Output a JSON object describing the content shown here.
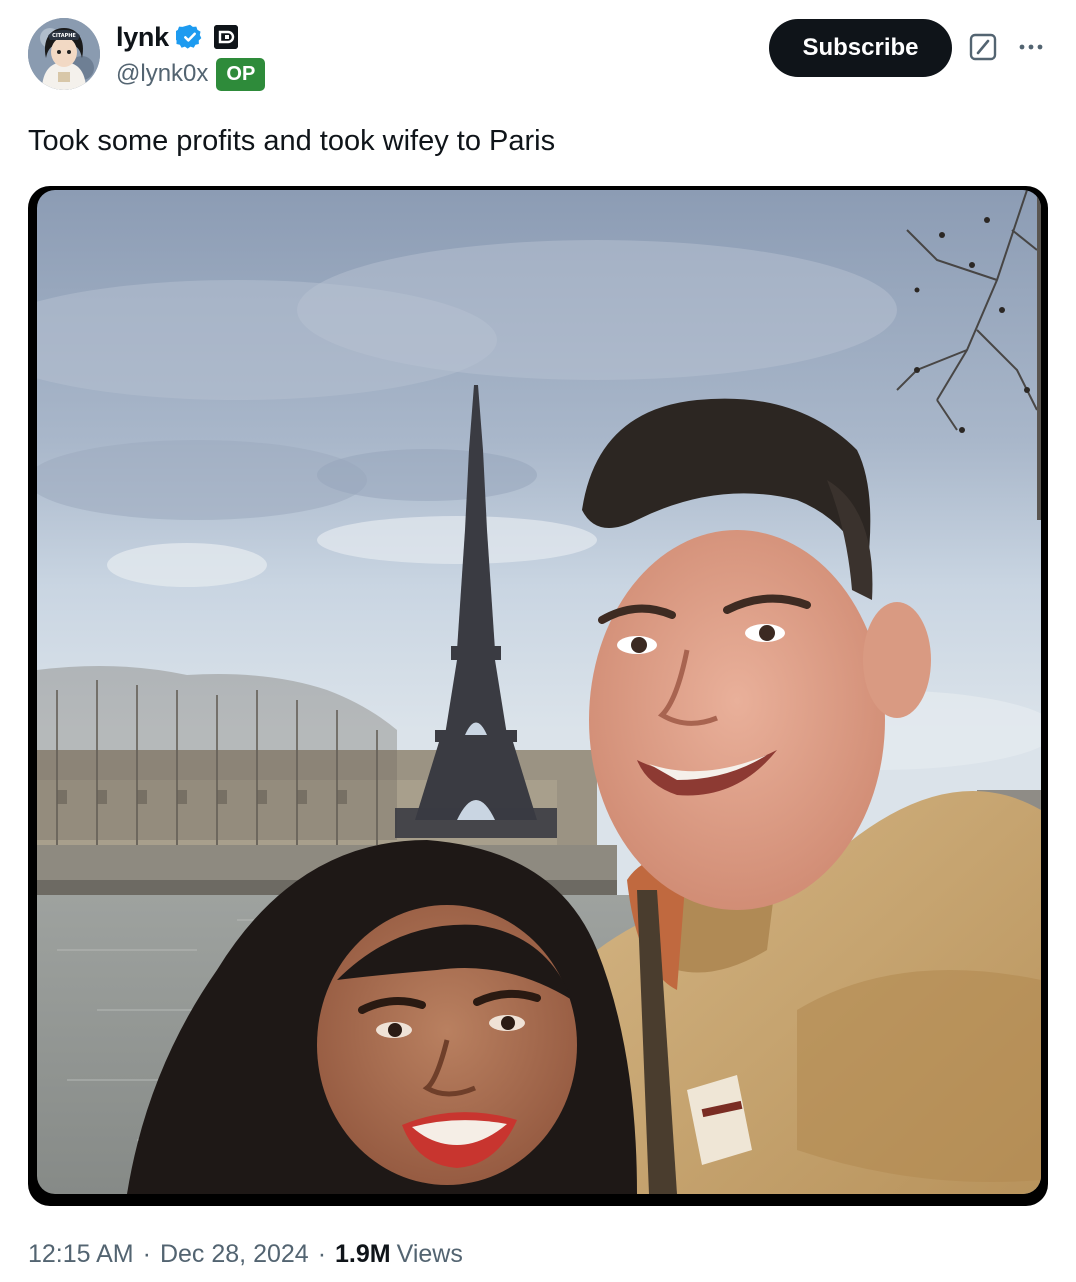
{
  "author": {
    "display_name": "lynk",
    "handle": "@lynk0x",
    "badge": "OP",
    "verified_color": "#1d9bf0",
    "badge_color": "#2e8b3a"
  },
  "actions": {
    "subscribe_label": "Subscribe"
  },
  "icons": {
    "verified": "verified-badge-icon",
    "affiliation": "affiliation-icon",
    "grok": "grok-icon",
    "more": "more-options-icon"
  },
  "tweet": {
    "text": "Took some profits and took wifey to Paris"
  },
  "media": {
    "image_subject": "photo"
  },
  "meta": {
    "time": "12:15 AM",
    "date": "Dec 28, 2024",
    "separator": "·",
    "views_count": "1.9M",
    "views_label": "Views"
  }
}
